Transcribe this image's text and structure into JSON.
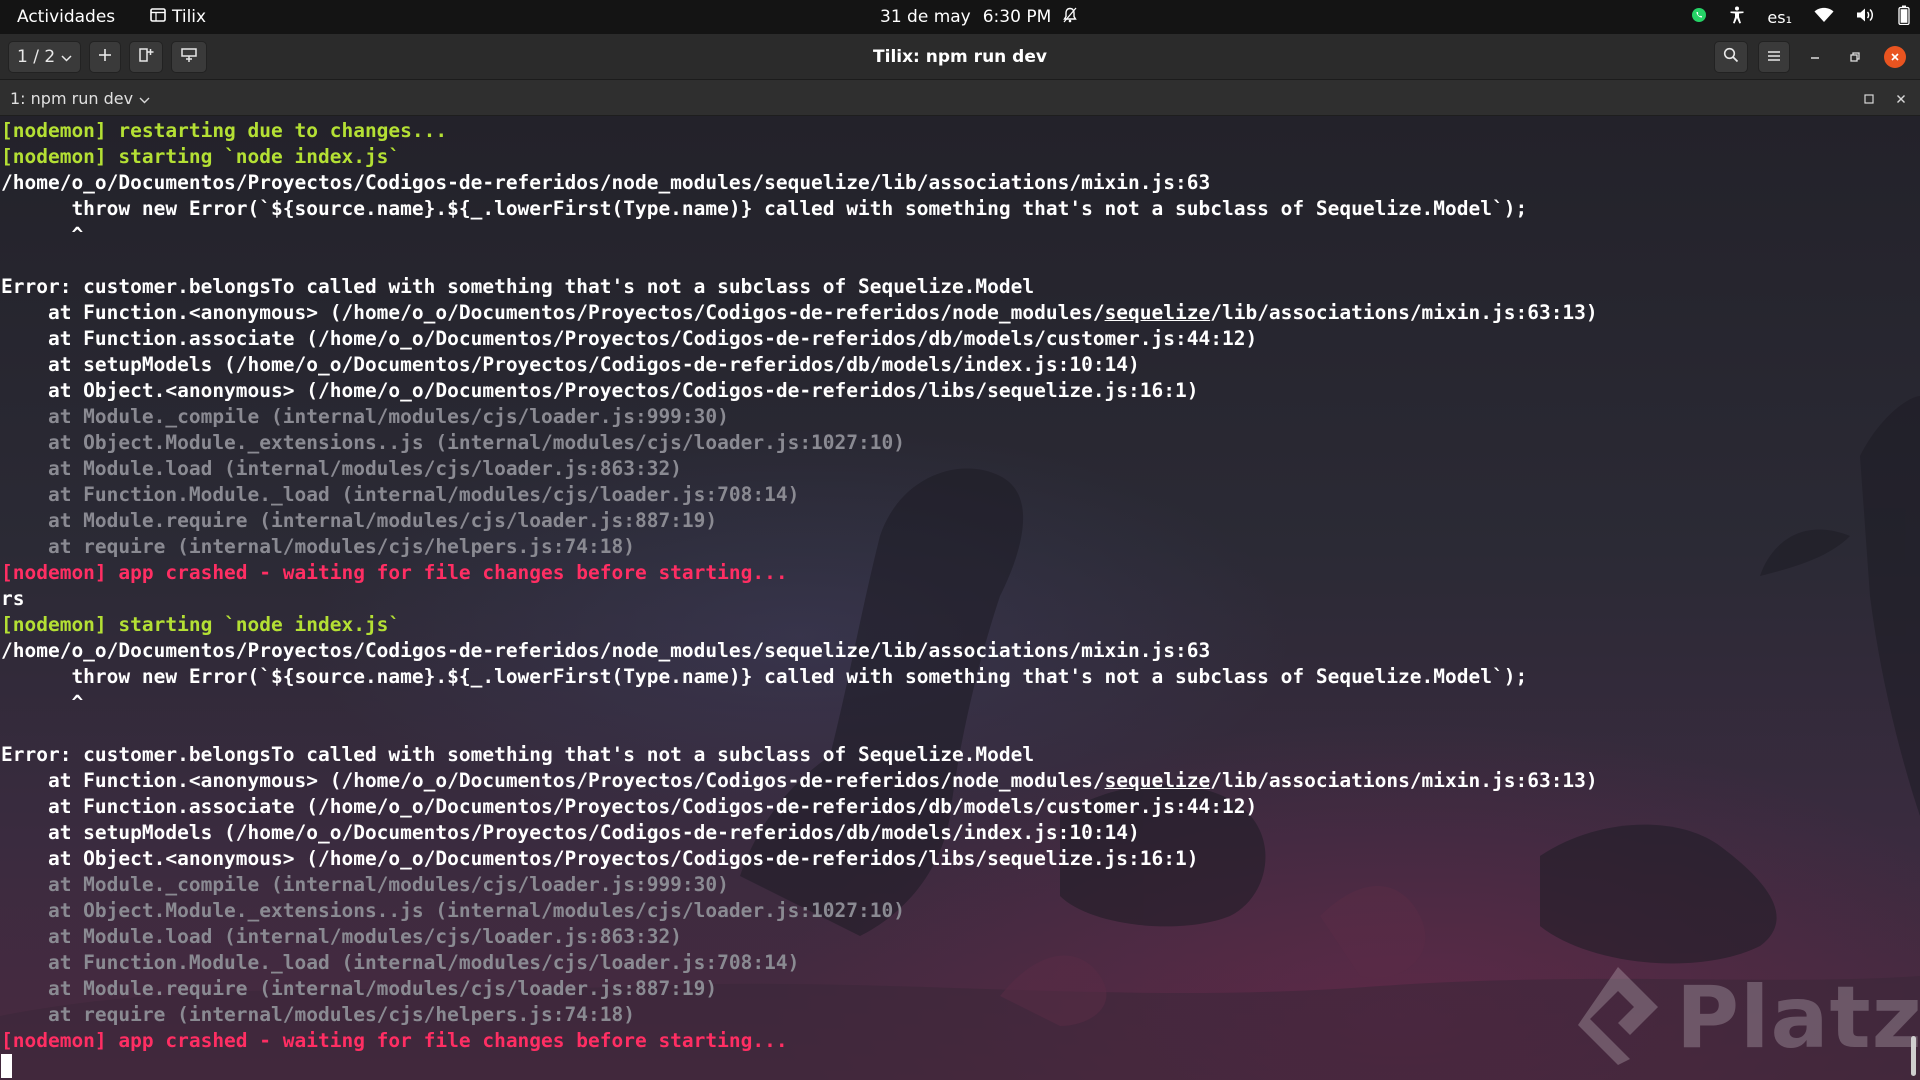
{
  "topbar": {
    "activities": "Actividades",
    "app_name": "Tilix",
    "date": "31 de may",
    "time": "6:30 PM",
    "lang": "es₁"
  },
  "titlebar": {
    "session_switcher": "1 / 2",
    "title": "Tilix: npm run dev"
  },
  "session": {
    "title": "1: npm run dev"
  },
  "terminal": {
    "lines": [
      {
        "text": "[nodemon] restarting due to changes...",
        "color": "#b4e034"
      },
      {
        "text": "[nodemon] starting `node index.js`",
        "color": "#b4e034"
      },
      {
        "text": "/home/o_o/Documentos/Proyectos/Codigos-de-referidos/node_modules/sequelize/lib/associations/mixin.js:63",
        "color": "#ffffff"
      },
      {
        "text": "      throw new Error(`${source.name}.${_.lowerFirst(Type.name)} called with something that's not a subclass of Sequelize.Model`);",
        "color": "#ffffff"
      },
      {
        "text": "      ^",
        "color": "#ffffff"
      },
      {
        "text": "",
        "color": "#ffffff"
      },
      {
        "text": "Error: customer.belongsTo called with something that's not a subclass of Sequelize.Model",
        "color": "#ffffff"
      },
      {
        "text_before": "    at Function.<anonymous> (/home/o_o/Documentos/Proyectos/Codigos-de-referidos/node_modules/",
        "text_underline": "sequelize",
        "text_after": "/lib/associations/mixin.js:63:13)",
        "color": "#ffffff"
      },
      {
        "text": "    at Function.associate (/home/o_o/Documentos/Proyectos/Codigos-de-referidos/db/models/customer.js:44:12)",
        "color": "#ffffff"
      },
      {
        "text": "    at setupModels (/home/o_o/Documentos/Proyectos/Codigos-de-referidos/db/models/index.js:10:14)",
        "color": "#ffffff"
      },
      {
        "text": "    at Object.<anonymous> (/home/o_o/Documentos/Proyectos/Codigos-de-referidos/libs/sequelize.js:16:1)",
        "color": "#ffffff"
      },
      {
        "text": "    at Module._compile (internal/modules/cjs/loader.js:999:30)",
        "color": "#8a8a92"
      },
      {
        "text": "    at Object.Module._extensions..js (internal/modules/cjs/loader.js:1027:10)",
        "color": "#8a8a92"
      },
      {
        "text": "    at Module.load (internal/modules/cjs/loader.js:863:32)",
        "color": "#8a8a92"
      },
      {
        "text": "    at Function.Module._load (internal/modules/cjs/loader.js:708:14)",
        "color": "#8a8a92"
      },
      {
        "text": "    at Module.require (internal/modules/cjs/loader.js:887:19)",
        "color": "#8a8a92"
      },
      {
        "text": "    at require (internal/modules/cjs/helpers.js:74:18)",
        "color": "#8a8a92"
      },
      {
        "text": "[nodemon] app crashed - waiting for file changes before starting...",
        "color": "#ff2e63"
      },
      {
        "text": "rs",
        "color": "#ffffff"
      },
      {
        "text": "[nodemon] starting `node index.js`",
        "color": "#b4e034"
      },
      {
        "text": "/home/o_o/Documentos/Proyectos/Codigos-de-referidos/node_modules/sequelize/lib/associations/mixin.js:63",
        "color": "#ffffff"
      },
      {
        "text": "      throw new Error(`${source.name}.${_.lowerFirst(Type.name)} called with something that's not a subclass of Sequelize.Model`);",
        "color": "#ffffff"
      },
      {
        "text": "      ^",
        "color": "#ffffff"
      },
      {
        "text": "",
        "color": "#ffffff"
      },
      {
        "text": "Error: customer.belongsTo called with something that's not a subclass of Sequelize.Model",
        "color": "#ffffff"
      },
      {
        "text_before": "    at Function.<anonymous> (/home/o_o/Documentos/Proyectos/Codigos-de-referidos/node_modules/",
        "text_underline": "sequelize",
        "text_after": "/lib/associations/mixin.js:63:13)",
        "color": "#ffffff"
      },
      {
        "text": "    at Function.associate (/home/o_o/Documentos/Proyectos/Codigos-de-referidos/db/models/customer.js:44:12)",
        "color": "#ffffff"
      },
      {
        "text": "    at setupModels (/home/o_o/Documentos/Proyectos/Codigos-de-referidos/db/models/index.js:10:14)",
        "color": "#ffffff"
      },
      {
        "text": "    at Object.<anonymous> (/home/o_o/Documentos/Proyectos/Codigos-de-referidos/libs/sequelize.js:16:1)",
        "color": "#ffffff"
      },
      {
        "text": "    at Module._compile (internal/modules/cjs/loader.js:999:30)",
        "color": "#8a8a92"
      },
      {
        "text": "    at Object.Module._extensions..js (internal/modules/cjs/loader.js:1027:10)",
        "color": "#8a8a92"
      },
      {
        "text": "    at Module.load (internal/modules/cjs/loader.js:863:32)",
        "color": "#8a8a92"
      },
      {
        "text": "    at Function.Module._load (internal/modules/cjs/loader.js:708:14)",
        "color": "#8a8a92"
      },
      {
        "text": "    at Module.require (internal/modules/cjs/loader.js:887:19)",
        "color": "#8a8a92"
      },
      {
        "text": "    at require (internal/modules/cjs/helpers.js:74:18)",
        "color": "#8a8a92"
      },
      {
        "text": "[nodemon] app crashed - waiting for file changes before starting...",
        "color": "#ff2e63"
      }
    ]
  },
  "watermark": {
    "text": "Platzi"
  },
  "icons": {
    "terminal_app": "terminal-app-icon",
    "notifications": "bell-icon",
    "whatsapp": "whatsapp-icon",
    "accessibility": "accessibility-icon",
    "wifi": "wifi-icon",
    "volume": "volume-icon",
    "battery": "battery-icon",
    "search": "search-icon",
    "menu": "hamburger-menu-icon"
  },
  "colors": {
    "prompt_green": "#b4e034",
    "error_red": "#ff2e63",
    "dim_gray": "#8a8a92",
    "close_orange": "#e95420"
  }
}
